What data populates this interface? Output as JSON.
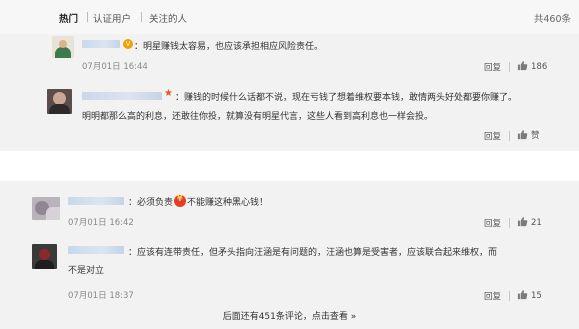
{
  "tabs": [
    {
      "label": "热门",
      "active": true
    },
    {
      "label": "认证用户",
      "active": false
    },
    {
      "label": "关注的人",
      "active": false
    }
  ],
  "total_label": "共460条",
  "comments": [
    {
      "text": "：明星赚钱太容易，也应该承担相应风险责任。",
      "time": "07月01日 16:44",
      "reply_label": "回复",
      "likes": "186",
      "badge": "v"
    },
    {
      "text_line1": "：赚钱的时候什么话都不说，现在亏钱了想着维权要本钱，敢情两头好处都要你赚了。",
      "text_line2": "明明都那么高的利息，还敢往你投，就算没有明星代言，这些人看到高利息也一样会投。",
      "reply_label": "回复",
      "likes_label": "赞",
      "badge": "star"
    },
    {
      "text_a": "：必须负责",
      "text_b": "不能赚这种黑心钱！",
      "emoji": "money",
      "time": "07月01日 16:42",
      "reply_label": "回复",
      "likes": "21"
    },
    {
      "text_line1": "：应该有连带责任，但矛头指向汪涵是有问题的，汪涵也算是受害者，应该联合起来维权，而",
      "text_line2": "不是对立",
      "time": "07月01日 18:37",
      "reply_label": "回复",
      "likes": "15"
    }
  ],
  "more_text": "后面还有451条评论，点击查看",
  "more_arrow": "»",
  "colors": {
    "panel_bg": "#f2f2f2",
    "tabs_bg": "#f7f7f7",
    "name_blur": "#c9d8ea",
    "v_badge": "#f0a100",
    "star_badge": "#e8541e"
  }
}
